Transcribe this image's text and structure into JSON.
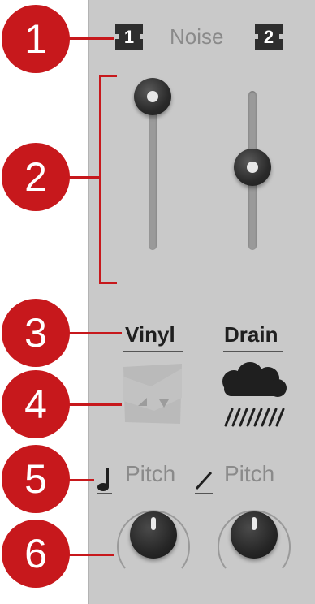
{
  "header": {
    "left_chip": "1",
    "title": "Noise",
    "right_chip": "2"
  },
  "callouts": [
    "1",
    "2",
    "3",
    "4",
    "5",
    "6"
  ],
  "sliders": {
    "slider_1_value": 1.0,
    "slider_2_value": 0.5
  },
  "modes": {
    "vinyl_label": "Vinyl",
    "drain_label": "Drain",
    "vinyl_icon": "vinyl-crackle-icon",
    "drain_icon": "rain-cloud-icon"
  },
  "pitch": {
    "left_label": "Pitch",
    "right_label": "Pitch",
    "left_icon": "note-icon",
    "right_icon": "slash-icon"
  },
  "colors": {
    "callout": "#c7181c",
    "panel": "#c9c9c9"
  }
}
